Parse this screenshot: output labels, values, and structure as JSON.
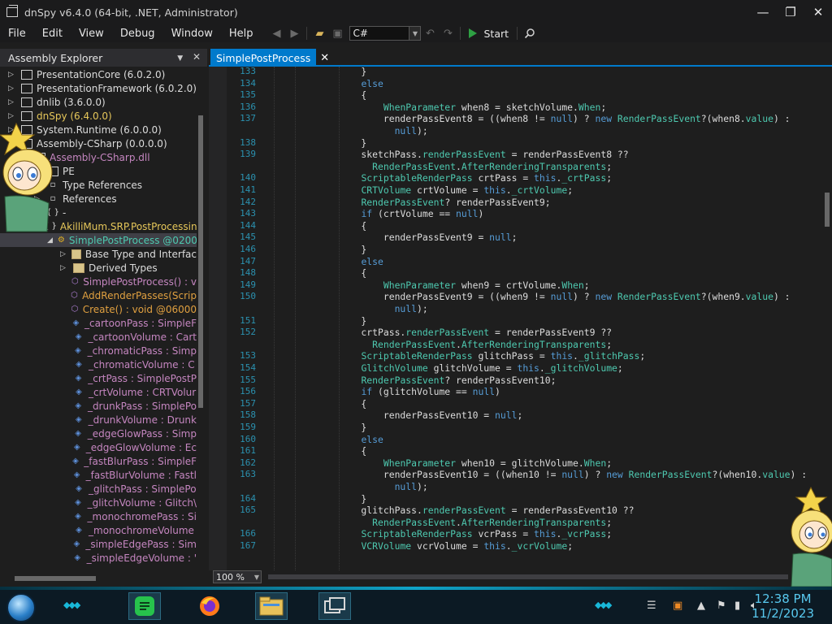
{
  "window": {
    "title": "dnSpy v6.4.0 (64-bit, .NET, Administrator)",
    "controls": {
      "minimize": "—",
      "maximize": "❐",
      "close": "✕"
    }
  },
  "menu": [
    "File",
    "Edit",
    "View",
    "Debug",
    "Window",
    "Help"
  ],
  "toolbar": {
    "language": "C#",
    "start_label": "Start"
  },
  "explorer": {
    "title": "Assembly Explorer",
    "items": [
      {
        "label": "PresentationCore (6.0.2.0)",
        "kind": "asm",
        "indent": 0,
        "expander": "▷"
      },
      {
        "label": "PresentationFramework (6.0.2.0)",
        "kind": "asm",
        "indent": 0,
        "expander": "▷"
      },
      {
        "label": "dnlib (3.6.0.0)",
        "kind": "asm",
        "indent": 0,
        "expander": "▷"
      },
      {
        "label": "dnSpy (6.4.0.0)",
        "kind": "asm",
        "indent": 0,
        "expander": "▷",
        "color": "yellow"
      },
      {
        "label": "System.Runtime (6.0.0.0)",
        "kind": "asm",
        "indent": 0,
        "expander": "▷"
      },
      {
        "label": "Assembly-CSharp (0.0.0.0)",
        "kind": "asm",
        "indent": 0,
        "expander": "◢"
      },
      {
        "label": "Assembly-CSharp.dll",
        "kind": "asm",
        "indent": 1,
        "expander": "◢",
        "color": "purple"
      },
      {
        "label": "PE",
        "kind": "asm",
        "indent": 2,
        "expander": "▷"
      },
      {
        "label": "Type References",
        "kind": "ref",
        "indent": 2,
        "expander": "▷"
      },
      {
        "label": "References",
        "kind": "ref",
        "indent": 2,
        "expander": "▷"
      },
      {
        "label": "-",
        "kind": "ns",
        "indent": 2,
        "expander": "▷"
      },
      {
        "label": "AkilliMum.SRP.PostProcessing",
        "kind": "ns",
        "indent": 2,
        "expander": "◢",
        "color": "yellow"
      },
      {
        "label": "SimplePostProcess @0200",
        "kind": "class",
        "indent": 3,
        "expander": "◢",
        "color": "teal",
        "selected": true
      },
      {
        "label": "Base Type and Interfac",
        "kind": "folder",
        "indent": 4,
        "expander": "▷"
      },
      {
        "label": "Derived Types",
        "kind": "folder",
        "indent": 4,
        "expander": "▷"
      },
      {
        "label": "SimplePostProcess() : v",
        "kind": "method",
        "indent": 4,
        "color": "purple"
      },
      {
        "label": "AddRenderPasses(Scrip",
        "kind": "method",
        "indent": 4,
        "color": "orange"
      },
      {
        "label": "Create() : void @06000",
        "kind": "method",
        "indent": 4,
        "color": "orange"
      },
      {
        "label": "_cartoonPass : SimpleF",
        "kind": "field",
        "indent": 4,
        "color": "purple"
      },
      {
        "label": "_cartoonVolume : Cart",
        "kind": "field",
        "indent": 4,
        "color": "purple"
      },
      {
        "label": "_chromaticPass : Simp",
        "kind": "field",
        "indent": 4,
        "color": "purple"
      },
      {
        "label": "_chromaticVolume : C",
        "kind": "field",
        "indent": 4,
        "color": "purple"
      },
      {
        "label": "_crtPass : SimplePostP",
        "kind": "field",
        "indent": 4,
        "color": "purple"
      },
      {
        "label": "_crtVolume : CRTVolur",
        "kind": "field",
        "indent": 4,
        "color": "purple"
      },
      {
        "label": "_drunkPass : SimplePo",
        "kind": "field",
        "indent": 4,
        "color": "purple"
      },
      {
        "label": "_drunkVolume : Drunk",
        "kind": "field",
        "indent": 4,
        "color": "purple"
      },
      {
        "label": "_edgeGlowPass : Simp",
        "kind": "field",
        "indent": 4,
        "color": "purple"
      },
      {
        "label": "_edgeGlowVolume : Ec",
        "kind": "field",
        "indent": 4,
        "color": "purple"
      },
      {
        "label": "_fastBlurPass : SimpleF",
        "kind": "field",
        "indent": 4,
        "color": "purple"
      },
      {
        "label": "_fastBlurVolume : Fastl",
        "kind": "field",
        "indent": 4,
        "color": "purple"
      },
      {
        "label": "_glitchPass : SimplePo",
        "kind": "field",
        "indent": 4,
        "color": "purple"
      },
      {
        "label": "_glitchVolume : Glitch\\",
        "kind": "field",
        "indent": 4,
        "color": "purple"
      },
      {
        "label": "_monochromePass : Si",
        "kind": "field",
        "indent": 4,
        "color": "purple"
      },
      {
        "label": "_monochromeVolume",
        "kind": "field",
        "indent": 4,
        "color": "purple"
      },
      {
        "label": "_simpleEdgePass : Sim",
        "kind": "field",
        "indent": 4,
        "color": "purple"
      },
      {
        "label": "_simpleEdgeVolume : '",
        "kind": "field",
        "indent": 4,
        "color": "purple"
      }
    ]
  },
  "editor": {
    "tab_title": "SimplePostProcess",
    "zoom": "100 %",
    "lines": [
      {
        "n": "133",
        "code": "    }"
      },
      {
        "n": "134",
        "code": "    <k>else</k>"
      },
      {
        "n": "135",
        "code": "    {"
      },
      {
        "n": "136",
        "code": "        <t>WhenParameter</t> when8 = sketchVolume.<p>When</p>;"
      },
      {
        "n": "137",
        "code": "        renderPassEvent8 = ((when8 != <k>null</k>) ? <k>new</k> <t>RenderPassEvent</t>?(when8.<p>value</p>) :"
      },
      {
        "n": "",
        "code": "          <k>null</k>);"
      },
      {
        "n": "138",
        "code": "    }"
      },
      {
        "n": "139",
        "code": "    sketchPass.<p>renderPassEvent</p> = renderPassEvent8 ??"
      },
      {
        "n": "",
        "code": "      <t>RenderPassEvent</t>.<p>AfterRenderingTransparents</p>;"
      },
      {
        "n": "140",
        "code": "    <t>ScriptableRenderPass</t> crtPass = <k>this</k>.<p>_crtPass</p>;"
      },
      {
        "n": "141",
        "code": "    <t>CRTVolume</t> crtVolume = <k>this</k>.<p>_crtVolume</p>;"
      },
      {
        "n": "142",
        "code": "    <t>RenderPassEvent</t>? renderPassEvent9;"
      },
      {
        "n": "143",
        "code": "    <k>if</k> (crtVolume == <k>null</k>)"
      },
      {
        "n": "144",
        "code": "    {"
      },
      {
        "n": "145",
        "code": "        renderPassEvent9 = <k>null</k>;"
      },
      {
        "n": "146",
        "code": "    }"
      },
      {
        "n": "147",
        "code": "    <k>else</k>"
      },
      {
        "n": "148",
        "code": "    {"
      },
      {
        "n": "149",
        "code": "        <t>WhenParameter</t> when9 = crtVolume.<p>When</p>;"
      },
      {
        "n": "150",
        "code": "        renderPassEvent9 = ((when9 != <k>null</k>) ? <k>new</k> <t>RenderPassEvent</t>?(when9.<p>value</p>) :"
      },
      {
        "n": "",
        "code": "          <k>null</k>);"
      },
      {
        "n": "151",
        "code": "    }"
      },
      {
        "n": "152",
        "code": "    crtPass.<p>renderPassEvent</p> = renderPassEvent9 ??"
      },
      {
        "n": "",
        "code": "      <t>RenderPassEvent</t>.<p>AfterRenderingTransparents</p>;"
      },
      {
        "n": "153",
        "code": "    <t>ScriptableRenderPass</t> glitchPass = <k>this</k>.<p>_glitchPass</p>;"
      },
      {
        "n": "154",
        "code": "    <t>GlitchVolume</t> glitchVolume = <k>this</k>.<p>_glitchVolume</p>;"
      },
      {
        "n": "155",
        "code": "    <t>RenderPassEvent</t>? renderPassEvent10;"
      },
      {
        "n": "156",
        "code": "    <k>if</k> (glitchVolume == <k>null</k>)"
      },
      {
        "n": "157",
        "code": "    {"
      },
      {
        "n": "158",
        "code": "        renderPassEvent10 = <k>null</k>;"
      },
      {
        "n": "159",
        "code": "    }"
      },
      {
        "n": "160",
        "code": "    <k>else</k>"
      },
      {
        "n": "161",
        "code": "    {"
      },
      {
        "n": "162",
        "code": "        <t>WhenParameter</t> when10 = glitchVolume.<p>When</p>;"
      },
      {
        "n": "163",
        "code": "        renderPassEvent10 = ((when10 != <k>null</k>) ? <k>new</k> <t>RenderPassEvent</t>?(when10.<p>value</p>) :"
      },
      {
        "n": "",
        "code": "          <k>null</k>);"
      },
      {
        "n": "164",
        "code": "    }"
      },
      {
        "n": "165",
        "code": "    glitchPass.<p>renderPassEvent</p> = renderPassEvent10 ??"
      },
      {
        "n": "",
        "code": "      <t>RenderPassEvent</t>.<p>AfterRenderingTransparents</p>;"
      },
      {
        "n": "166",
        "code": "    <t>ScriptableRenderPass</t> vcrPass = <k>this</k>.<p>_vcrPass</p>;"
      },
      {
        "n": "167",
        "code": "    <t>VCRVolume</t> vcrVolume = <k>this</k>.<p>_vcrVolume</p>;"
      }
    ]
  },
  "taskbar": {
    "apps": [
      "notes-app",
      "firefox",
      "file-explorer",
      "task-view"
    ],
    "time": "12:38 PM",
    "date": "11/2/2023"
  },
  "colors": {
    "accent": "#007acc",
    "keyword": "#569cd6",
    "type": "#4ec9b0",
    "line_number": "#2b91af",
    "clock": "#58c8ee"
  }
}
